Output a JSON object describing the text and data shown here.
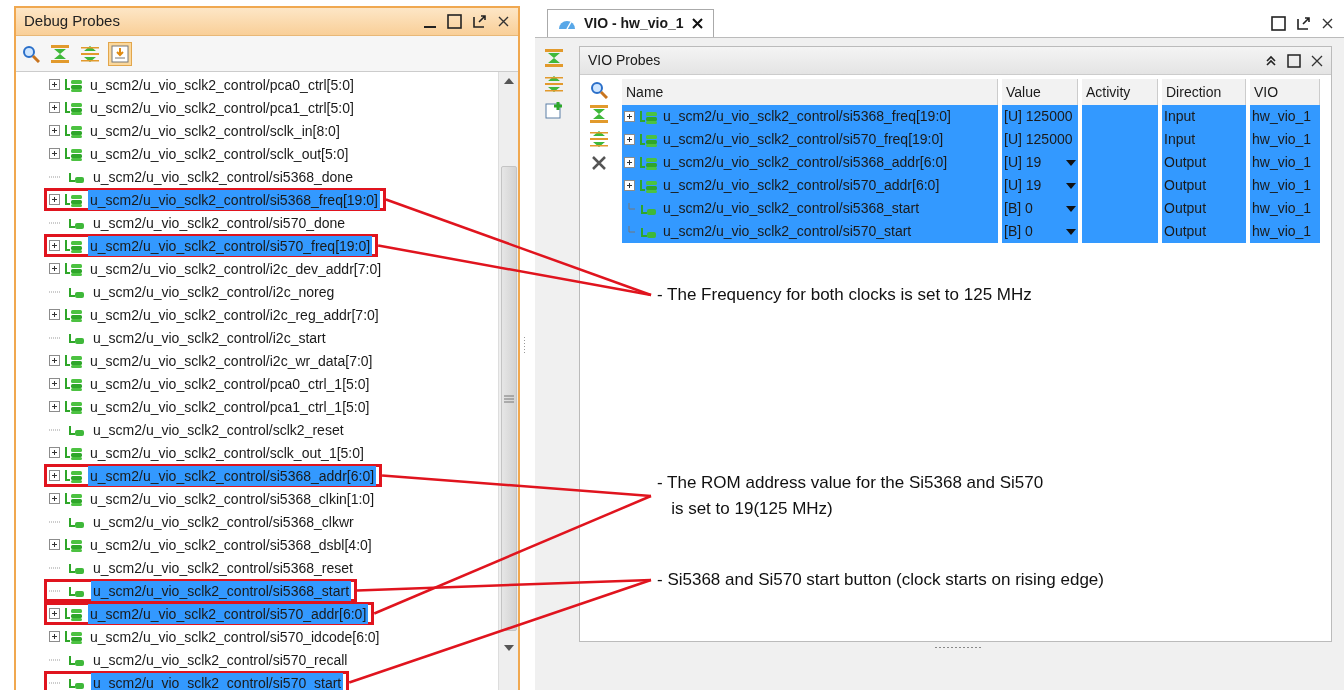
{
  "debug_probes": {
    "title": "Debug Probes",
    "toolbar": [
      {
        "kind": "search",
        "selected": false
      },
      {
        "kind": "collapse",
        "selected": false
      },
      {
        "kind": "expand",
        "selected": false
      },
      {
        "kind": "auto",
        "selected": true
      }
    ],
    "rows": [
      {
        "kind": "bus",
        "label": "u_scm2/u_vio_sclk2_control/pca0_ctrl[5:0]",
        "selected": false
      },
      {
        "kind": "bus",
        "label": "u_scm2/u_vio_sclk2_control/pca1_ctrl[5:0]",
        "selected": false
      },
      {
        "kind": "bus",
        "label": "u_scm2/u_vio_sclk2_control/sclk_in[8:0]",
        "selected": false
      },
      {
        "kind": "bus",
        "label": "u_scm2/u_vio_sclk2_control/sclk_out[5:0]",
        "selected": false
      },
      {
        "kind": "bit",
        "label": "u_scm2/u_vio_sclk2_control/si5368_done",
        "selected": false
      },
      {
        "kind": "bus",
        "label": "u_scm2/u_vio_sclk2_control/si5368_freq[19:0]",
        "selected": true,
        "callout": {
          "kind": "frequency"
        }
      },
      {
        "kind": "bit",
        "label": "u_scm2/u_vio_sclk2_control/si570_done",
        "selected": false
      },
      {
        "kind": "bus",
        "label": "u_scm2/u_vio_sclk2_control/si570_freq[19:0]",
        "selected": true,
        "callout": {
          "kind": "frequency"
        }
      },
      {
        "kind": "bus",
        "label": "u_scm2/u_vio_sclk2_control/i2c_dev_addr[7:0]",
        "selected": false
      },
      {
        "kind": "bit",
        "label": "u_scm2/u_vio_sclk2_control/i2c_noreg",
        "selected": false
      },
      {
        "kind": "bus",
        "label": "u_scm2/u_vio_sclk2_control/i2c_reg_addr[7:0]",
        "selected": false
      },
      {
        "kind": "bit",
        "label": "u_scm2/u_vio_sclk2_control/i2c_start",
        "selected": false
      },
      {
        "kind": "bus",
        "label": "u_scm2/u_vio_sclk2_control/i2c_wr_data[7:0]",
        "selected": false
      },
      {
        "kind": "bus",
        "label": "u_scm2/u_vio_sclk2_control/pca0_ctrl_1[5:0]",
        "selected": false
      },
      {
        "kind": "bus",
        "label": "u_scm2/u_vio_sclk2_control/pca1_ctrl_1[5:0]",
        "selected": false
      },
      {
        "kind": "bit",
        "label": "u_scm2/u_vio_sclk2_control/sclk2_reset",
        "selected": false
      },
      {
        "kind": "bus",
        "label": "u_scm2/u_vio_sclk2_control/sclk_out_1[5:0]",
        "selected": false
      },
      {
        "kind": "bus",
        "label": "u_scm2/u_vio_sclk2_control/si5368_addr[6:0]",
        "selected": true,
        "callout": {
          "kind": "address"
        }
      },
      {
        "kind": "bus",
        "label": "u_scm2/u_vio_sclk2_control/si5368_clkin[1:0]",
        "selected": false
      },
      {
        "kind": "bit",
        "label": "u_scm2/u_vio_sclk2_control/si5368_clkwr",
        "selected": false
      },
      {
        "kind": "bus",
        "label": "u_scm2/u_vio_sclk2_control/si5368_dsbl[4:0]",
        "selected": false
      },
      {
        "kind": "bit",
        "label": "u_scm2/u_vio_sclk2_control/si5368_reset",
        "selected": false
      },
      {
        "kind": "bit",
        "label": "u_scm2/u_vio_sclk2_control/si5368_start",
        "selected": true,
        "callout": {
          "kind": "start"
        }
      },
      {
        "kind": "bus",
        "label": "u_scm2/u_vio_sclk2_control/si570_addr[6:0]",
        "selected": true,
        "callout": {
          "kind": "address"
        }
      },
      {
        "kind": "bus",
        "label": "u_scm2/u_vio_sclk2_control/si570_idcode[6:0]",
        "selected": false
      },
      {
        "kind": "bit",
        "label": "u_scm2/u_vio_sclk2_control/si570_recall",
        "selected": false
      },
      {
        "kind": "bit",
        "label": "u_scm2/u_vio_sclk2_control/si570_start",
        "selected": true,
        "callout": {
          "kind": "start"
        }
      }
    ]
  },
  "vio": {
    "tab": {
      "title": "VIO - hw_vio_1",
      "selected": true
    },
    "side_toolbar": [
      {
        "kind": "collapse"
      },
      {
        "kind": "expand"
      },
      {
        "kind": "add"
      }
    ],
    "probes": {
      "title": "VIO Probes",
      "toolbar": [
        {
          "kind": "search"
        },
        {
          "kind": "collapse"
        },
        {
          "kind": "expand"
        },
        {
          "kind": "delete"
        }
      ],
      "columns": [
        "Name",
        "Value",
        "Activity",
        "Direction",
        "VIO"
      ],
      "rows": [
        {
          "kind": "bus",
          "name": "u_scm2/u_vio_sclk2_control/si5368_freq[19:0]",
          "value": "[U] 125000",
          "dropdown": false,
          "direction": "Input",
          "vio": "hw_vio_1",
          "selected": true
        },
        {
          "kind": "bus",
          "name": "u_scm2/u_vio_sclk2_control/si570_freq[19:0]",
          "value": "[U] 125000",
          "dropdown": false,
          "direction": "Input",
          "vio": "hw_vio_1",
          "selected": true
        },
        {
          "kind": "bus",
          "name": "u_scm2/u_vio_sclk2_control/si5368_addr[6:0]",
          "value": "[U] 19",
          "dropdown": true,
          "direction": "Output",
          "vio": "hw_vio_1",
          "selected": true
        },
        {
          "kind": "bus",
          "name": "u_scm2/u_vio_sclk2_control/si570_addr[6:0]",
          "value": "[U] 19",
          "dropdown": true,
          "direction": "Output",
          "vio": "hw_vio_1",
          "selected": true
        },
        {
          "kind": "bit",
          "name": "u_scm2/u_vio_sclk2_control/si5368_start",
          "value": "[B] 0",
          "dropdown": true,
          "direction": "Output",
          "vio": "hw_vio_1",
          "selected": true
        },
        {
          "kind": "bit",
          "name": "u_scm2/u_vio_sclk2_control/si570_start",
          "value": "[B] 0",
          "dropdown": true,
          "direction": "Output",
          "vio": "hw_vio_1",
          "selected": true
        }
      ]
    }
  },
  "annotations": [
    {
      "kind": "frequency",
      "text": "- The Frequency for both clocks is set to 125 MHz"
    },
    {
      "kind": "address",
      "text": "- The ROM address value for the Si5368 and Si570\n   is set to 19(125 MHz)"
    },
    {
      "kind": "start",
      "text": "- Si5368 and Si570 start button (clock starts on rising edge)"
    }
  ]
}
